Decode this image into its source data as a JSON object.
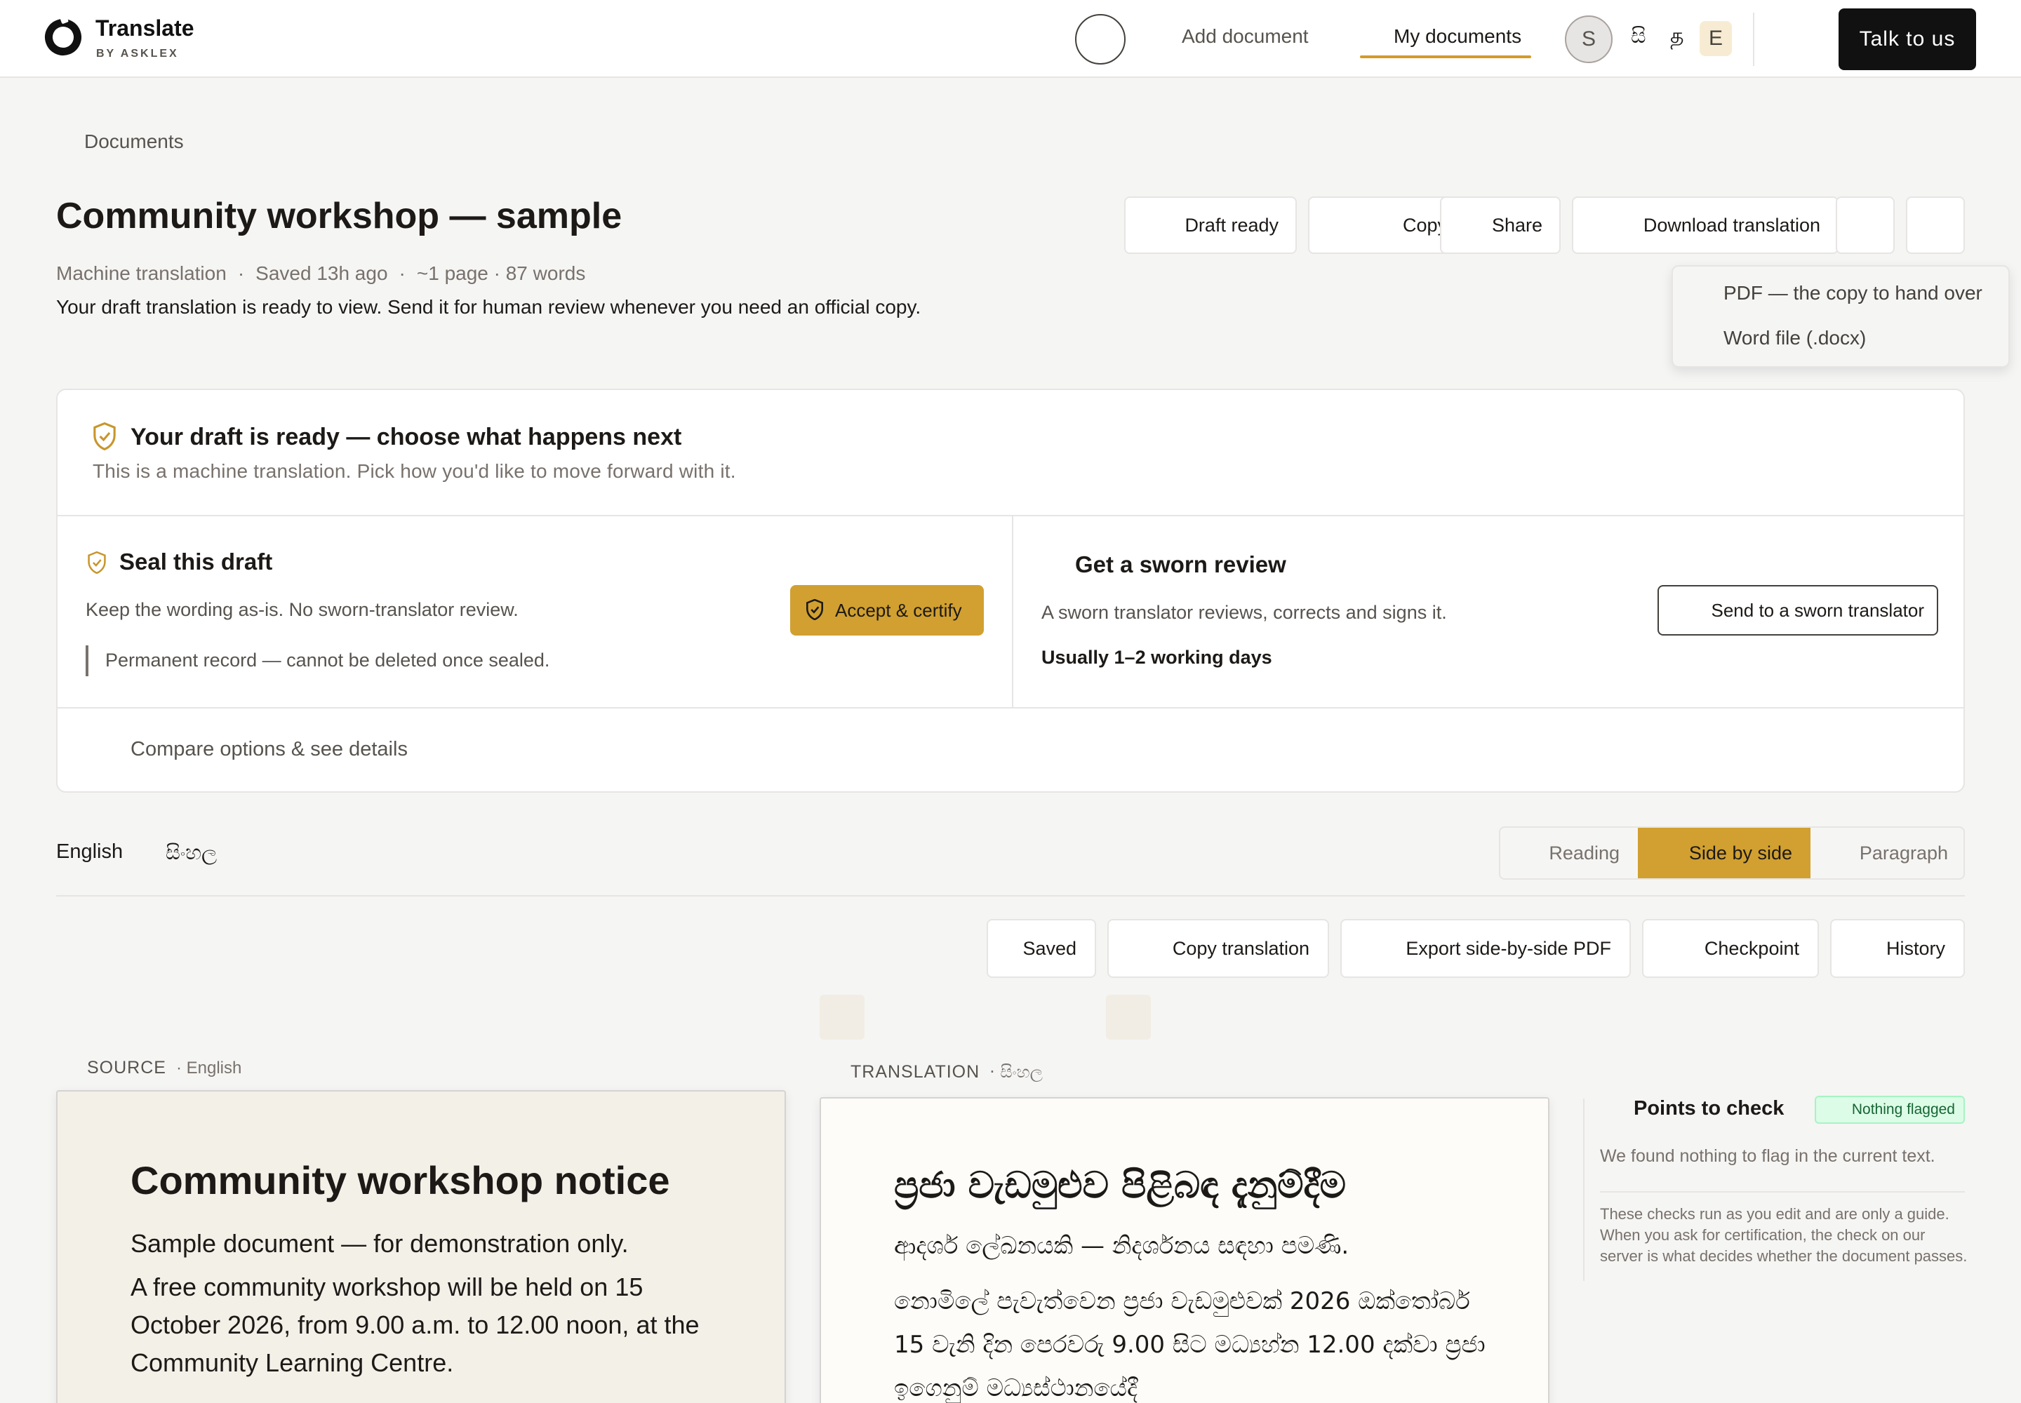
{
  "brand": {
    "title": "Translate",
    "subtitle": "BY ASKLEX"
  },
  "nav": {
    "add_document": "Add document",
    "my_documents": "My documents",
    "avatar_initial": "S",
    "lang_sinhala": "සි",
    "lang_tamil": "த",
    "lang_english": "E",
    "talk_to_us": "Talk to us"
  },
  "header": {
    "breadcrumb": "Documents",
    "title": "Community workshop — sample",
    "meta": {
      "mode": "Machine translation",
      "saved": "Saved 13h ago",
      "size": "~1 page · 87 words"
    },
    "description": "Your draft translation is ready to view. Send it for human review whenever you need an official copy.",
    "buttons": {
      "status": "Draft ready",
      "copy": "Copy",
      "share": "Share",
      "download": "Download translation"
    }
  },
  "download_menu": {
    "items": [
      "PDF — the copy to hand over",
      "Word file (.docx)"
    ]
  },
  "ready_card": {
    "title": "Your draft is ready — choose what happens next",
    "subtitle": "This is a machine translation. Pick how you'd like to move forward with it.",
    "seal": {
      "title": "Seal this draft",
      "text": "Keep the wording as-is. No sworn-translator review.",
      "note": "Permanent record — cannot be deleted once sealed.",
      "button": "Accept & certify"
    },
    "sworn": {
      "title": "Get a sworn review",
      "text": "A sworn translator reviews, corrects and signs it.",
      "eta": "Usually 1–2 working days",
      "button": "Send to a sworn translator"
    },
    "compare": "Compare options & see details"
  },
  "languages": {
    "source": "English",
    "target": "සිංහල"
  },
  "view_modes": {
    "reading": "Reading",
    "side_by_side": "Side by side",
    "paragraph": "Paragraph",
    "active": "Side by side"
  },
  "toolbar": {
    "saved": "Saved",
    "copy_translation": "Copy translation",
    "export_pdf": "Export side-by-side PDF",
    "checkpoint": "Checkpoint",
    "history": "History"
  },
  "source": {
    "label": "SOURCE",
    "lang": "· English",
    "heading": "Community workshop notice",
    "subtitle": "Sample document — for demonstration only.",
    "body": "A free community workshop will be held on 15 October 2026, from 9.00 a.m. to 12.00 noon, at the Community Learning Centre."
  },
  "translation": {
    "label": "TRANSLATION",
    "lang": "· සිංහල",
    "heading": "ප්‍රජා වැඩමුළුව පිළිබඳ දැනුම්දීම",
    "subtitle": "ආදර්ශ ලේඛනයකි — නිදර්ශනය සඳහා පමණි.",
    "body": "නොමිලේ පැවැත්වෙන ප්‍රජා වැඩමුළුවක් 2026 ඔක්තෝබර් 15 වැනි දින පෙරවරු 9.00 සිට මධ්‍යහ්න 12.00 දක්වා ප්‍රජා ඉගෙනුම් මධ්‍යස්ථානයේදී"
  },
  "points_to_check": {
    "title": "Points to check",
    "badge": "Nothing flagged",
    "text": "We found nothing to flag in the current text.",
    "note": "These checks run as you edit and are only a guide. When you ask for certification, the check on our server is what decides whether the document passes."
  },
  "colors": {
    "accent": "#d1a030",
    "ink": "#1c1917",
    "muted": "#78716c",
    "success_bg": "#dcfce7"
  }
}
